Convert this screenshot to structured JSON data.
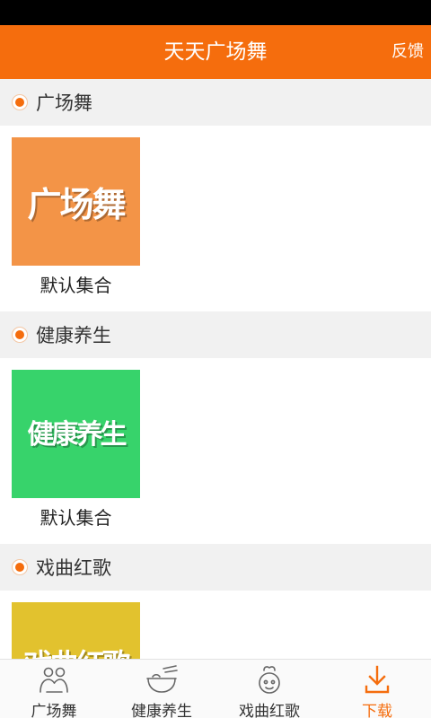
{
  "header": {
    "title": "天天广场舞",
    "feedback_label": "反馈"
  },
  "sections": [
    {
      "title": "广场舞",
      "tile": {
        "image_text": "广场舞",
        "caption": "默认集合",
        "color": "#f39447"
      }
    },
    {
      "title": "健康养生",
      "tile": {
        "image_text": "健康养生",
        "caption": "默认集合",
        "color": "#37d36b"
      }
    },
    {
      "title": "戏曲红歌",
      "tile": {
        "image_text": "戏曲红歌",
        "color": "#e2c22e"
      }
    }
  ],
  "bottom_nav": [
    {
      "label": "广场舞",
      "icon": "dancers-icon"
    },
    {
      "label": "健康养生",
      "icon": "bowl-icon"
    },
    {
      "label": "戏曲红歌",
      "icon": "mic-badge-icon"
    },
    {
      "label": "下载",
      "icon": "download-icon",
      "active": true
    }
  ],
  "colors": {
    "accent": "#f56d0d",
    "status_bar": "#000000",
    "section_bg": "#f1f1f1"
  }
}
